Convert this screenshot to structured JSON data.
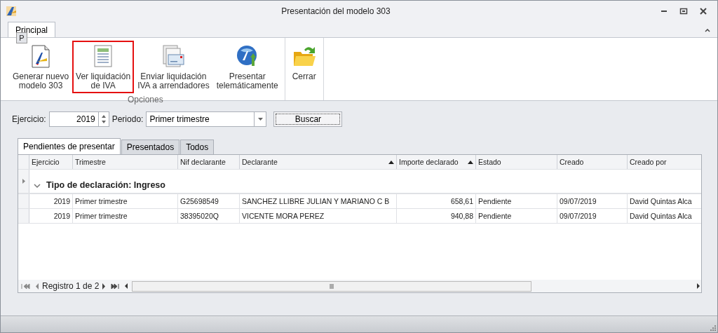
{
  "window": {
    "title": "Presentación del modelo 303"
  },
  "ribbon": {
    "tabs": [
      {
        "label": "Principal",
        "selected": true,
        "keytip": "P"
      }
    ],
    "groups": [
      {
        "label": "Opciones",
        "buttons": [
          {
            "lines": [
              "Generar nuevo",
              "modelo 303"
            ],
            "highlighted": false
          },
          {
            "lines": [
              "Ver liquidación",
              "de IVA"
            ],
            "highlighted": true
          },
          {
            "lines": [
              "Enviar liquidación",
              "IVA a arrendadores"
            ],
            "highlighted": false
          },
          {
            "lines": [
              "Presentar",
              "telemáticamente"
            ],
            "highlighted": false
          }
        ]
      },
      {
        "buttons": [
          {
            "lines": [
              "Cerrar"
            ],
            "highlighted": false
          }
        ]
      }
    ]
  },
  "filter": {
    "ejercicio_label": "Ejercicio:",
    "ejercicio": "2019",
    "periodo_label": "Periodo:",
    "periodo": "Primer trimestre",
    "search_button": "Buscar"
  },
  "tabs": [
    {
      "label": "Pendientes de presentar",
      "selected": true
    },
    {
      "label": "Presentados",
      "selected": false
    },
    {
      "label": "Todos",
      "selected": false
    }
  ],
  "grid": {
    "columns": [
      {
        "label": "Ejercicio",
        "kind": "number"
      },
      {
        "label": "Trimestre",
        "kind": "text"
      },
      {
        "label": "Nif declarante",
        "kind": "text"
      },
      {
        "label": "Declarante",
        "kind": "text",
        "sorted": true
      },
      {
        "label": "Importe declarado",
        "kind": "number",
        "sorted": true
      },
      {
        "label": "Estado",
        "kind": "text"
      },
      {
        "label": "Creado",
        "kind": "text"
      },
      {
        "label": "Creado por",
        "kind": "text"
      }
    ],
    "group": {
      "label": "Tipo de declaración: Ingreso",
      "expanded": true
    },
    "rows": [
      [
        "2019",
        "Primer trimestre",
        "G25698549",
        "SANCHEZ LLIBRE JULIAN Y MARIANO C B",
        "658,61",
        "Pendiente",
        "09/07/2019",
        "David Quintas Alca"
      ],
      [
        "2019",
        "Primer trimestre",
        "38395020Q",
        "VICENTE MORA PEREZ",
        "940,88",
        "Pendiente",
        "09/07/2019",
        "David Quintas Alca"
      ]
    ],
    "navigator": {
      "text": "Registro 1 de 2"
    }
  }
}
